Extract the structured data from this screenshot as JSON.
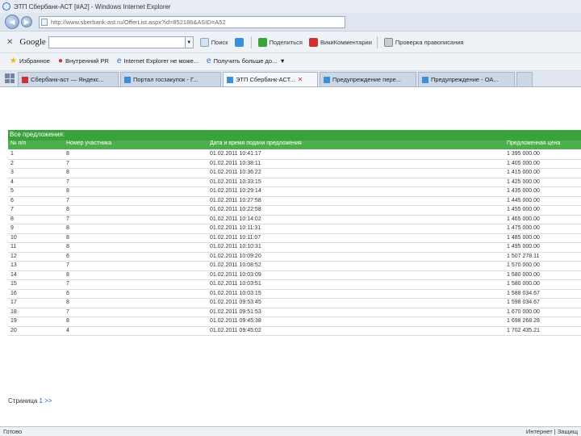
{
  "window": {
    "title": "ЭТП Сбербанк-АСТ [#A2] - Windows Internet Explorer"
  },
  "address": {
    "url": "http://www.sberbank-ast.ru/OfferList.aspx?id=852186&ASID=A52"
  },
  "toolbar": {
    "google_label": "Google",
    "search_label": "Поиск",
    "share_label": "Поделиться",
    "wiki_label": "ВикиКомментарии",
    "spell_label": "Проверка правописания"
  },
  "favorites": {
    "items": [
      {
        "label": "Избранное"
      },
      {
        "label": "Внутренний PR"
      },
      {
        "label": "Internet Explorer не може..."
      },
      {
        "label": "Получить больше до..."
      }
    ]
  },
  "tabs": [
    {
      "label": "Сбербанк-аст — Яндекс..."
    },
    {
      "label": "Портал госзакупок - Г..."
    },
    {
      "label": "ЭТП Сбербанк-АСТ..."
    },
    {
      "label": "Предупреждение пере..."
    },
    {
      "label": "Предупреждение - ОА..."
    }
  ],
  "offers": {
    "title": "Все предложения:",
    "columns": [
      "№ п/п",
      "Номер участника",
      "Дата и время подачи предложения",
      "Предложенная цена"
    ],
    "rows": [
      [
        "1",
        "8",
        "01.02.2011 10:41:17",
        "1 395 000.00"
      ],
      [
        "2",
        "7",
        "01.02.2011 10:38:11",
        "1 405 000.00"
      ],
      [
        "3",
        "8",
        "01.02.2011 10:36:22",
        "1 415 000.00"
      ],
      [
        "4",
        "7",
        "01.02.2011 10:33:15",
        "1 425 000.00"
      ],
      [
        "5",
        "8",
        "01.02.2011 10:29:14",
        "1 435 000.00"
      ],
      [
        "6",
        "7",
        "01.02.2011 10:27:58",
        "1 445 000.00"
      ],
      [
        "7",
        "8",
        "01.02.2011 10:22:58",
        "1 455 000.00"
      ],
      [
        "8",
        "7",
        "01.02.2011 10:14:02",
        "1 465 000.00"
      ],
      [
        "9",
        "8",
        "01.02.2011 10:11:31",
        "1 475 000.00"
      ],
      [
        "10",
        "8",
        "01.02.2011 10:11:07",
        "1 485 000.00"
      ],
      [
        "11",
        "8",
        "01.02.2011 10:10:31",
        "1 495 000.00"
      ],
      [
        "12",
        "6",
        "01.02.2011 10:09:20",
        "1 507 278.11"
      ],
      [
        "13",
        "7",
        "01.02.2011 10:08:52",
        "1 570 000.00"
      ],
      [
        "14",
        "8",
        "01.02.2011 10:03:09",
        "1 580 000.00"
      ],
      [
        "15",
        "7",
        "01.02.2011 10:03:51",
        "1 580 000.00"
      ],
      [
        "16",
        "6",
        "01.02.2011 10:03:15",
        "1 588 034.67"
      ],
      [
        "17",
        "8",
        "01.02.2011 09:53:45",
        "1 598 034.67"
      ],
      [
        "18",
        "7",
        "01.02.2011 09:51:53",
        "1 670 000.00"
      ],
      [
        "19",
        "8",
        "01.02.2011 09:45:38",
        "1 698 268.28"
      ],
      [
        "20",
        "4",
        "01.02.2011 09:45:02",
        "1 702 435.21"
      ]
    ]
  },
  "pager": {
    "label": "Страница",
    "current": "1",
    "next": ">>"
  },
  "status": {
    "left": "Готово",
    "zone": "Интернет | Защищ"
  }
}
